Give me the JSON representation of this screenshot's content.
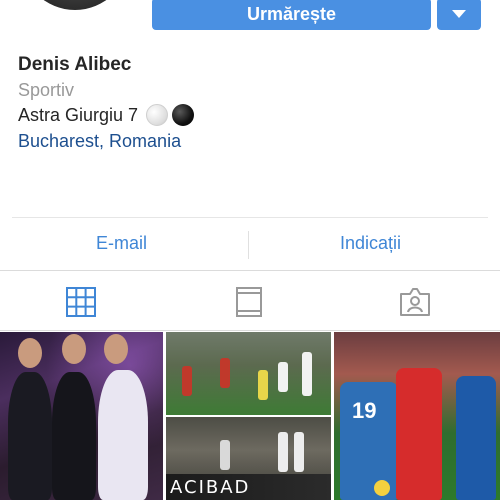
{
  "profile": {
    "follow_label": "Urmărește",
    "name": "Denis Alibec",
    "category": "Sportiv",
    "bio_text": "Astra Giurgiu 7",
    "location": "Bucharest, Romania"
  },
  "contact": {
    "email_label": "E-mail",
    "directions_label": "Indicații"
  },
  "tabs": [
    {
      "icon": "grid-icon"
    },
    {
      "icon": "feed-icon"
    },
    {
      "icon": "tagged-icon"
    }
  ],
  "photos": {
    "ad_text": "ACIBAD",
    "jersey_number": "19"
  },
  "colors": {
    "accent": "#4a90e2",
    "link": "#3f86d6",
    "location": "#1d4f8f"
  }
}
